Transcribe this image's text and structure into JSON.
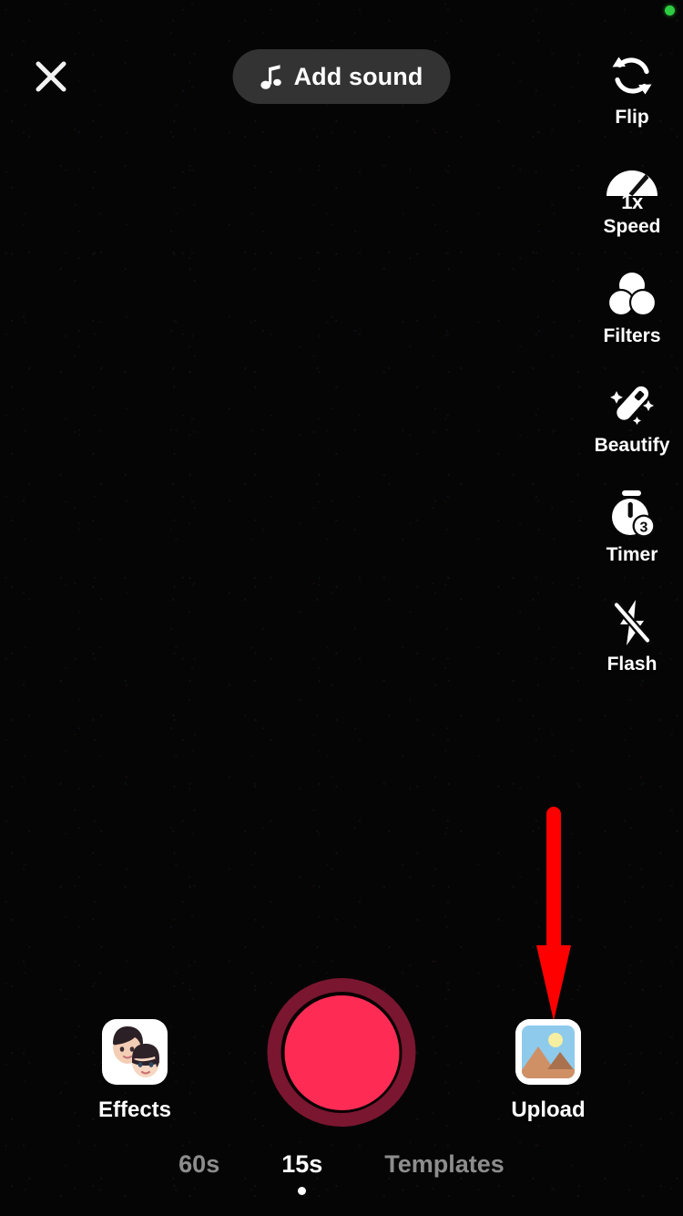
{
  "app": {
    "screen_name": "TikTok Camera",
    "background_color": "#050505",
    "accent_color": "#fe2c55",
    "annotation_color": "#ff0000"
  },
  "status": {
    "camera_indicator": "green-dot",
    "camera_indicator_color": "#2ecc40"
  },
  "topbar": {
    "close_icon": "close-icon",
    "add_sound": {
      "label": "Add sound",
      "icon": "music-note-icon"
    }
  },
  "rail": {
    "items": [
      {
        "label": "Flip",
        "icon": "flip-camera-icon"
      },
      {
        "label": "Speed",
        "icon": "speedometer-icon",
        "value": "1",
        "unit": "x"
      },
      {
        "label": "Filters",
        "icon": "filters-icon"
      },
      {
        "label": "Beautify",
        "icon": "magic-wand-icon"
      },
      {
        "label": "Timer",
        "icon": "stopwatch-icon",
        "badge": "3"
      },
      {
        "label": "Flash",
        "icon": "flash-off-icon"
      }
    ]
  },
  "bottom": {
    "effects": {
      "label": "Effects",
      "icon": "effects-faces-icon"
    },
    "record": {
      "label": "Record",
      "icon": "record-button",
      "inner_color": "#fe2c55",
      "ring_color": "#7a1630"
    },
    "upload": {
      "label": "Upload",
      "icon": "photo-gallery-icon"
    }
  },
  "modes": {
    "tabs": [
      {
        "label": "60s",
        "active": false
      },
      {
        "label": "15s",
        "active": true
      },
      {
        "label": "Templates",
        "active": false
      }
    ]
  },
  "annotation": {
    "arrow": "down-arrow-annotation",
    "points_to": "Upload"
  }
}
